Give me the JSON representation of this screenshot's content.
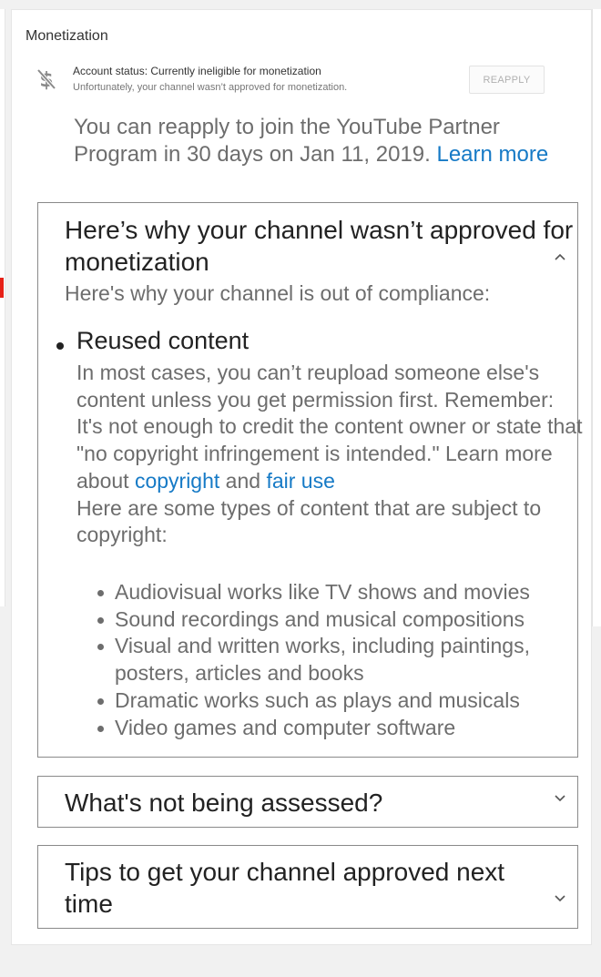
{
  "card": {
    "title": "Monetization",
    "status": {
      "icon": "no-dollar-icon",
      "label": "Account status: Currently ineligible for monetization",
      "detail": "Unfortunately, your channel wasn’t approved for monetization.",
      "reapply_button": "REAPPLY"
    },
    "reapply_info": {
      "text": "You can reapply to join the YouTube Partner Program in 30 days on Jan 11, 2019.",
      "link": "Learn more"
    }
  },
  "panels": {
    "why": {
      "title": "Here’s why your channel wasn’t approved for monetization",
      "icon": "chevron-up-icon",
      "subtitle": "Here's why your channel is out of compliance:",
      "issue": {
        "title": "Reused content",
        "body_1": "In most cases, you can’t reupload someone else's content unless you get permission first. Remember: It's not enough to credit the content owner or state that \"no copyright infringement is intended.\" Learn more about",
        "link_copyright": "copyright",
        "and": "and",
        "link_fair_use": "fair use",
        "body_2": "Here are some types of content that are subject to copyright:",
        "items": [
          "Audiovisual works like TV shows and movies",
          "Sound recordings and musical compositions",
          "Visual and written works, including paintings, posters, articles and books",
          "Dramatic works such as plays and musicals",
          "Video games and computer software"
        ]
      }
    },
    "not_assessed": {
      "title": "What's not being assessed?",
      "icon": "chevron-down-icon"
    },
    "tips": {
      "title": "Tips to get your channel approved next time",
      "icon": "chevron-down-icon"
    }
  },
  "colors": {
    "link": "#167ac6",
    "accent_red": "#e62117",
    "muted_text": "#6d6d6d"
  }
}
